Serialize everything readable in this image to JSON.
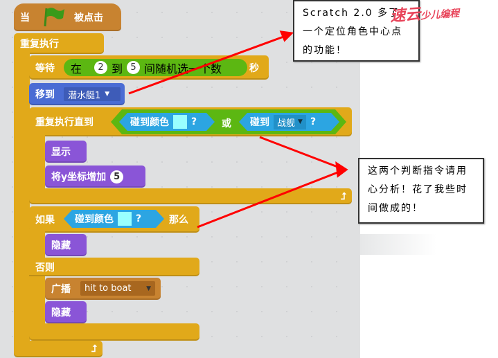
{
  "script": {
    "hat": {
      "when": "当",
      "clicked": "被点击"
    },
    "forever": "重复执行",
    "wait": {
      "label": "等待",
      "in": "在",
      "from": "2",
      "to_word": "到",
      "to": "5",
      "random": "间随机选一个数",
      "unit": "秒"
    },
    "goto": {
      "label": "移到",
      "target": "潜水艇1"
    },
    "repeat_until": {
      "label": "重复执行直到",
      "touch_color": "碰到颜色",
      "q": "?",
      "or": "或",
      "touch": "碰到",
      "sprite": "战舰"
    },
    "show": "显示",
    "change_y": {
      "label": "将y坐标增加",
      "value": "5"
    },
    "if": {
      "label": "如果",
      "touch_color": "碰到颜色",
      "q": "?",
      "then": "那么"
    },
    "hide1": "隐藏",
    "else": "否则",
    "broadcast": {
      "label": "广播",
      "message": "hit to boat"
    },
    "hide2": "隐藏"
  },
  "colors": {
    "control": "#e1a91a",
    "events": "#c88330",
    "motion": "#4a6cd4",
    "looks": "#8a55d7",
    "operators": "#5cb712",
    "sensing": "#2ca5e2",
    "touch_color": "#99ffff",
    "arrow": "#ff0000"
  },
  "comments": [
    {
      "text": "Scratch 2.0 多了一个定位角色中心点的功能！"
    },
    {
      "text": "这两个判断指令请用心分析！花了我些时间做成的！"
    }
  ],
  "watermark": "速云少儿编程"
}
